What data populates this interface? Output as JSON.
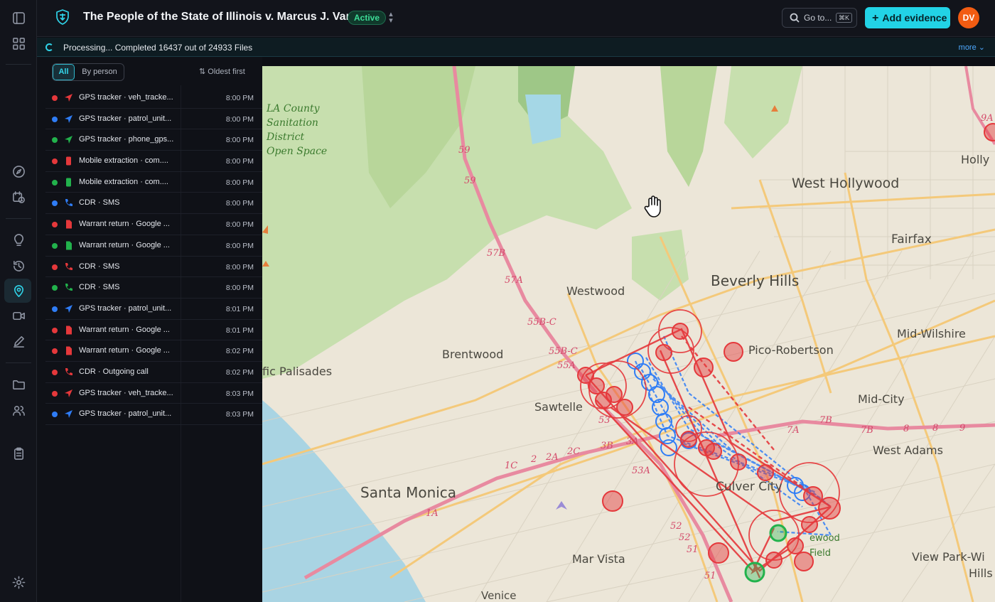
{
  "case": {
    "title": "The People of the State of Illinois v. Marcus J. Vance",
    "status": "Active"
  },
  "header": {
    "goto_label": "Go to...",
    "goto_shortcut": "⌘K",
    "add_evidence": "Add evidence",
    "avatar_initials": "DV"
  },
  "processing": {
    "text": "Processing... Completed 16437 out of 24933 Files",
    "more": "more ⌄"
  },
  "filters": {
    "all": "All",
    "by_person": "By person",
    "sort": "Oldest first"
  },
  "colors": {
    "accent": "#22d3e6",
    "red": "#e5383b",
    "blue": "#2f7df6",
    "green": "#22b24c"
  },
  "evidence": [
    {
      "label": "GPS tracker · veh_tracke...",
      "time": "8:00 PM",
      "person_color": "red",
      "icon": "navigation-arrow-icon"
    },
    {
      "label": "GPS tracker · patrol_unit...",
      "time": "8:00 PM",
      "person_color": "blue",
      "icon": "navigation-arrow-icon"
    },
    {
      "label": "GPS tracker · phone_gps...",
      "time": "8:00 PM",
      "person_color": "green",
      "icon": "navigation-arrow-icon"
    },
    {
      "label": "Mobile extraction · com....",
      "time": "8:00 PM",
      "person_color": "red",
      "icon": "phone-device-icon"
    },
    {
      "label": "Mobile extraction · com....",
      "time": "8:00 PM",
      "person_color": "green",
      "icon": "phone-device-icon"
    },
    {
      "label": "CDR · SMS",
      "time": "8:00 PM",
      "person_color": "blue",
      "icon": "phone-handset-icon"
    },
    {
      "label": "Warrant return · Google ...",
      "time": "8:00 PM",
      "person_color": "red",
      "icon": "document-icon"
    },
    {
      "label": "Warrant return · Google ...",
      "time": "8:00 PM",
      "person_color": "green",
      "icon": "document-icon"
    },
    {
      "label": "CDR · SMS",
      "time": "8:00 PM",
      "person_color": "red",
      "icon": "phone-handset-icon"
    },
    {
      "label": "CDR · SMS",
      "time": "8:00 PM",
      "person_color": "green",
      "icon": "phone-handset-icon"
    },
    {
      "label": "GPS tracker · patrol_unit...",
      "time": "8:01 PM",
      "person_color": "blue",
      "icon": "navigation-arrow-icon"
    },
    {
      "label": "Warrant return · Google ...",
      "time": "8:01 PM",
      "person_color": "red",
      "icon": "document-icon"
    },
    {
      "label": "Warrant return · Google ...",
      "time": "8:02 PM",
      "person_color": "red",
      "icon": "document-icon"
    },
    {
      "label": "CDR · Outgoing call",
      "time": "8:02 PM",
      "person_color": "red",
      "icon": "phone-handset-icon"
    },
    {
      "label": "GPS tracker · veh_tracke...",
      "time": "8:03 PM",
      "person_color": "red",
      "icon": "navigation-arrow-icon"
    },
    {
      "label": "GPS tracker · patrol_unit...",
      "time": "8:03 PM",
      "person_color": "blue",
      "icon": "navigation-arrow-icon"
    }
  ],
  "map": {
    "places": {
      "west_hollywood": "West Hollywood",
      "fairfax": "Fairfax",
      "beverly_hills": "Beverly Hills",
      "westwood": "Westwood",
      "mid_wilshire": "Mid-Wilshire",
      "brentwood": "Brentwood",
      "pico_robertson": "Pico-Robertson",
      "palisades": "fic Palisades",
      "sawtelle": "Sawtelle",
      "mid_city": "Mid-City",
      "west_adams": "West Adams",
      "santa_monica": "Santa Monica",
      "culver_city": "Culver City",
      "mar_vista": "Mar Vista",
      "view_park": "View Park-Wi",
      "hills": "Hills",
      "venice": "Venice",
      "holly": "Holly",
      "inglewood_a": "ewood",
      "inglewood_b": "Field",
      "la_county_1": "LA County",
      "la_county_2": "Sanitation",
      "la_county_3": "District",
      "la_county_4": "Open Space"
    },
    "exits": {
      "e59a": "59",
      "e59b": "59",
      "e57b": "57B",
      "e57a": "57A",
      "e55bc": "55B-C",
      "e55bc2": "55B-C",
      "e55a": "55A",
      "e53": "53",
      "e3b": "3B",
      "e3a": "3A",
      "e2a": "2A",
      "e2c": "2C",
      "e2": "2",
      "e1c": "1C",
      "e1a": "1A",
      "e53a": "53A",
      "e52": "52",
      "e52b": "52",
      "e51": "51",
      "e51b": "51",
      "e7a": "7A",
      "e7b": "7B",
      "e7b2": "7B",
      "e8": "8",
      "e8b": "8",
      "e9": "9",
      "e9a": "9A"
    }
  }
}
